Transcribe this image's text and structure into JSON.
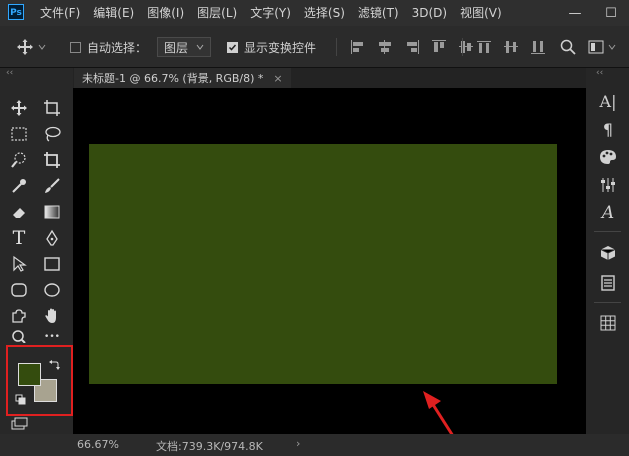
{
  "app": {
    "logo": "Ps"
  },
  "menu": [
    "文件(F)",
    "编辑(E)",
    "图像(I)",
    "图层(L)",
    "文字(Y)",
    "选择(S)",
    "滤镜(T)",
    "3D(D)",
    "视图(V)"
  ],
  "window_controls": {
    "minimize": "—",
    "maximize": "☐"
  },
  "options": {
    "auto_select_label": "自动选择：",
    "auto_select_checked": false,
    "target_dropdown": "图层",
    "show_transform_label": "显示变换控件",
    "show_transform_checked": true
  },
  "panel_collapse": "‹‹",
  "document": {
    "tab_title": "未标题-1 @ 66.7% (背景, RGB/8) *",
    "close_glyph": "×",
    "fill_color": "#344c0e"
  },
  "colors": {
    "foreground": "#344c0e",
    "background": "#a8a390",
    "highlight": "#e02020",
    "arrow": "#e02020"
  },
  "right_tools": {
    "character": "A|",
    "paragraph": "¶",
    "type_style": "A"
  },
  "toolbar": {
    "type_glyph": "T",
    "more_glyph": "•••"
  },
  "status": {
    "zoom": "66.67%",
    "doc_size": "文档:739.3K/974.8K",
    "arrow": "›"
  }
}
